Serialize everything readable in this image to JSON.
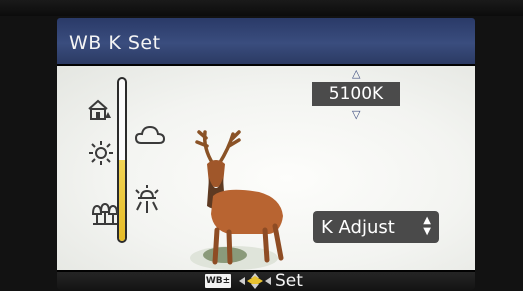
{
  "header": {
    "title": "WB K Set"
  },
  "kelvin": {
    "value": "5100K"
  },
  "slider": {
    "level_percent": 50
  },
  "controls": {
    "k_adjust_label": "K Adjust"
  },
  "footer": {
    "badge": "WB±",
    "set_label": "Set"
  },
  "colors": {
    "titlebar": "#34477a",
    "slider_fill": "#e8c231",
    "accent": "#3c4c7e"
  },
  "icons": [
    "house-shade-icon",
    "sun-icon",
    "incandescent-icon",
    "cloud-icon",
    "flash-icon",
    "up-arrow-icon",
    "down-arrow-icon",
    "wb-adjust-icon",
    "multi-direction-pad-icon"
  ]
}
